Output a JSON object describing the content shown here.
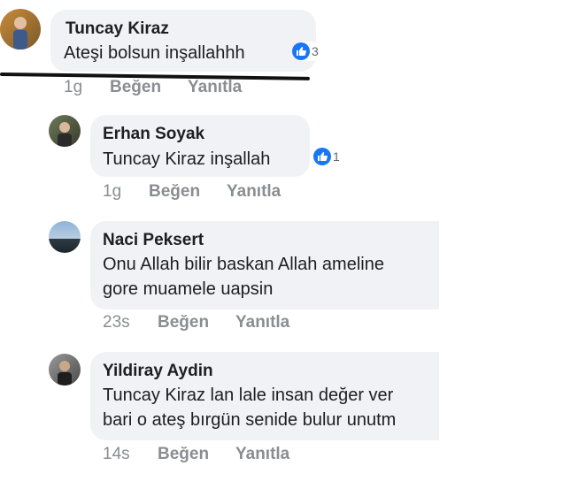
{
  "comments": [
    {
      "author": "Tuncay Kiraz",
      "text_lines": [
        "Ateşi bolsun inşallahhh"
      ],
      "like_count": "3",
      "time": "1g",
      "like_label": "Beğen",
      "reply_label": "Yanıtla"
    },
    {
      "author": "Erhan Soyak",
      "text_lines": [
        "Tuncay Kiraz inşallah"
      ],
      "like_count": "1",
      "time": "1g",
      "like_label": "Beğen",
      "reply_label": "Yanıtla"
    },
    {
      "author": "Naci Peksert",
      "text_lines": [
        "Onu Allah bilir baskan Allah ameline",
        "gore muamele uapsin"
      ],
      "time": "23s",
      "like_label": "Beğen",
      "reply_label": "Yanıtla"
    },
    {
      "author": "Yildiray Aydin",
      "text_lines": [
        "Tuncay Kiraz lan lale insan  değer ver",
        "bari o ateş bırgün senide bulur unutm"
      ],
      "time": "14s",
      "like_label": "Beğen",
      "reply_label": "Yanıtla"
    }
  ],
  "colors": {
    "bubble": "#f0f2f5",
    "meta": "#8a8d91",
    "like_blue": "#1877f2"
  }
}
